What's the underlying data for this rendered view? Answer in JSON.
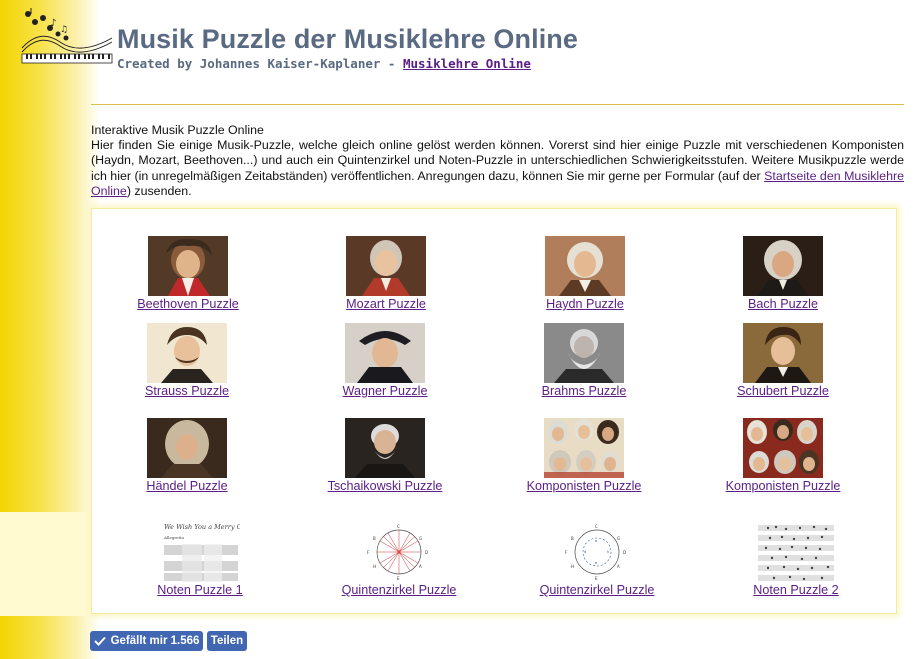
{
  "header": {
    "title": "Musik Puzzle der Musiklehre Online",
    "subtitle_prefix": "Created by Johannes Kaiser-Kaplaner - ",
    "subtitle_link": "Musiklehre Online",
    "logo_icon": "music-notes-piano-logo-icon"
  },
  "intro": {
    "heading": "Interaktive Musik Puzzle Online",
    "text_1": "Hier finden Sie einige Musik-Puzzle, welche gleich online gelöst werden können. Vorerst sind hier einige Puzzle mit verschiedenen Komponisten (Haydn, Mozart, Beethoven...) und auch ein Quintenzirkel und Noten-Puzzle in unterschiedlichen Schwierigkeitsstufen. Weitere Musikpuzzle werde ich hier (in unregelmäßigen Zeitabständen) veröffentlichen. Anregungen dazu, können Sie mir gerne per Formular (auf der ",
    "link": "Startseite den Musiklehre Online",
    "text_2": ") zusenden."
  },
  "puzzles": [
    {
      "label": "Beethoven Puzzle",
      "icon": "beethoven-portrait-icon"
    },
    {
      "label": "Mozart Puzzle",
      "icon": "mozart-portrait-icon"
    },
    {
      "label": "Haydn Puzzle",
      "icon": "haydn-portrait-icon"
    },
    {
      "label": "Bach Puzzle",
      "icon": "bach-portrait-icon"
    },
    {
      "label": "Strauss Puzzle",
      "icon": "strauss-portrait-icon"
    },
    {
      "label": "Wagner Puzzle",
      "icon": "wagner-portrait-icon"
    },
    {
      "label": "Brahms Puzzle",
      "icon": "brahms-portrait-icon"
    },
    {
      "label": "Schubert Puzzle",
      "icon": "schubert-portrait-icon"
    },
    {
      "label": "Händel Puzzle",
      "icon": "haendel-portrait-icon"
    },
    {
      "label": "Tschaikowski Puzzle",
      "icon": "tschaikowski-portrait-icon"
    },
    {
      "label": "Komponisten Puzzle",
      "icon": "composers-collage-icon"
    },
    {
      "label": "Komponisten Puzzle",
      "icon": "composers-collage-icon"
    },
    {
      "label": "Noten Puzzle 1",
      "icon": "sheet-music-icon",
      "sheet_title": "We Wish You a Merry Christmas",
      "sheet_tempo": "Allegretto"
    },
    {
      "label": "Quintenzirkel Puzzle",
      "icon": "circle-of-fifths-icon"
    },
    {
      "label": "Quintenzirkel Puzzle",
      "icon": "circle-of-fifths-icon"
    },
    {
      "label": "Noten Puzzle 2",
      "icon": "sheet-music-icon"
    }
  ],
  "social": {
    "like_label": "Gefällt mir 1.566",
    "share_label": "Teilen",
    "like_icon": "checkmark-icon",
    "color": "#4267b2"
  },
  "colors": {
    "gradient_yellow": "#f4d400",
    "title": "#5a6a82",
    "link": "#5a1e86"
  }
}
